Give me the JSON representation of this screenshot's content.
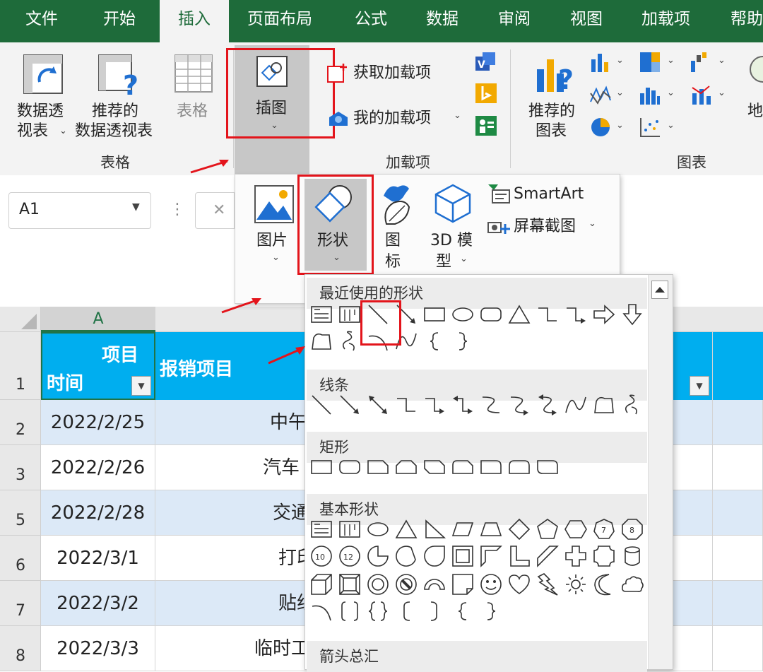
{
  "tabs": [
    {
      "label": "文件"
    },
    {
      "label": "开始"
    },
    {
      "label": "插入",
      "active": true
    },
    {
      "label": "页面布局"
    },
    {
      "label": "公式"
    },
    {
      "label": "数据"
    },
    {
      "label": "审阅"
    },
    {
      "label": "视图"
    },
    {
      "label": "加载项"
    },
    {
      "label": "帮助"
    }
  ],
  "ribbon": {
    "pivot_line1": "数据透",
    "pivot_line2": "视表",
    "rec_pivot_line1": "推荐的",
    "rec_pivot_line2": "数据透视表",
    "table": "表格",
    "illustrations": "插图",
    "get_addins": "获取加载项",
    "my_addins": "我的加载项",
    "rec_charts_line1": "推荐的",
    "rec_charts_line2": "图表",
    "map_partial": "地",
    "group_tables": "表格",
    "group_addins": "加载项",
    "group_charts": "图表"
  },
  "formula_bar": {
    "name_box": "A1",
    "x_symbol": "✕",
    "dots": "⋮"
  },
  "insert_panel": {
    "pictures": "图片",
    "shapes": "形状",
    "icons_line1": "图",
    "icons_line2": "标",
    "model3d_line1": "3D 模",
    "model3d_line2": "型",
    "smartart": "SmartArt",
    "screenshot": "屏幕截图"
  },
  "shapes_menu": {
    "recent": "最近使用的形状",
    "lines": "线条",
    "rectangles": "矩形",
    "basic": "基本形状",
    "arrows": "箭头总汇"
  },
  "sheet": {
    "col_a": "A",
    "header_top": "项目",
    "header_bottom": "时间",
    "header_b": "报销项目",
    "rows": [
      {
        "num": "1"
      },
      {
        "num": "2",
        "date": "2022/2/25",
        "item": "中午"
      },
      {
        "num": "3",
        "date": "2022/2/26",
        "item": "汽车"
      },
      {
        "num": "5",
        "date": "2022/2/28",
        "item": "交通"
      },
      {
        "num": "6",
        "date": "2022/3/1",
        "item": "打印"
      },
      {
        "num": "7",
        "date": "2022/3/2",
        "item": "贴纸"
      },
      {
        "num": "8",
        "date": "2022/3/3",
        "item": "临时工"
      }
    ]
  },
  "colors": {
    "excel_green": "#1e6b3a",
    "header_cyan": "#00aeef",
    "band_blue": "#dce9f7",
    "highlight_red": "#e3141b"
  }
}
